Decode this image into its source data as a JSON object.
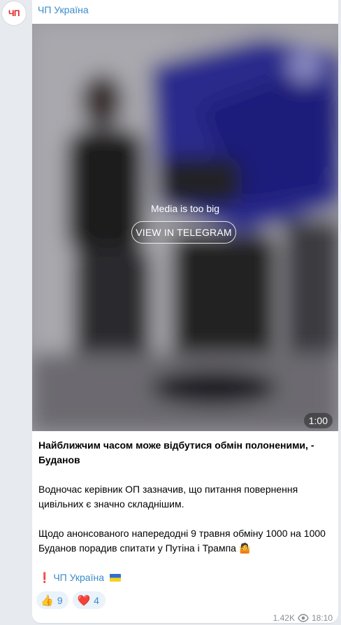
{
  "channel": {
    "avatar_text": "ЧП",
    "name": "ЧП Україна"
  },
  "media": {
    "note": "Media is too big",
    "button_label": "VIEW IN TELEGRAM",
    "duration": "1:00"
  },
  "post": {
    "title": "Найближчим часом може відбутися обмін полоненими, - Буданов",
    "paragraph1": "Водночас керівник ОП зазначив, що питання повернення цивільних є значно складнішим.",
    "paragraph2": "Щодо анонсованого напередодні 9 травня обміну 1000 на 1000 Буданов порадив спитати у Путіна і Трампа 🤷",
    "signature_mark": "❗",
    "signature": "ЧП Україна"
  },
  "reactions": [
    {
      "emoji": "👍",
      "count": "9"
    },
    {
      "emoji": "❤️",
      "count": "4"
    }
  ],
  "footer": {
    "views": "1.42K",
    "time": "18:10"
  }
}
